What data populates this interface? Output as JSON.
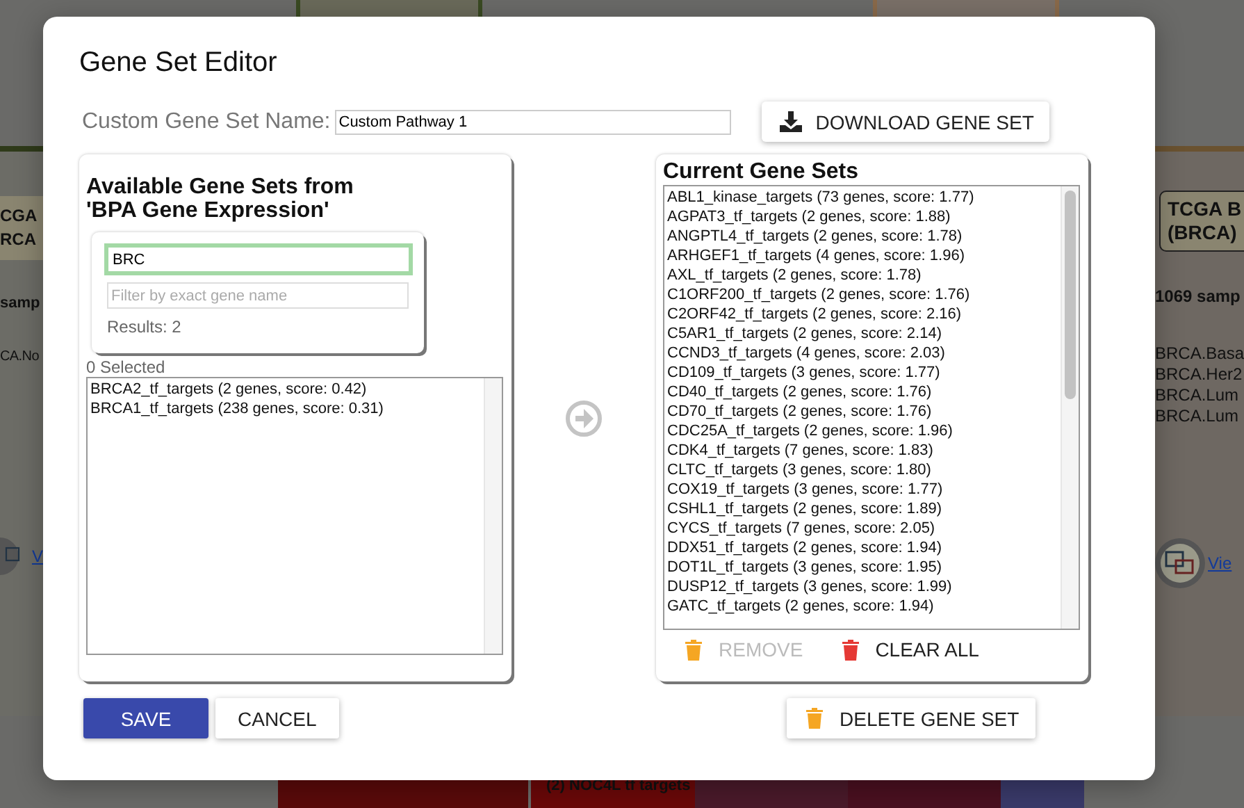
{
  "background": {
    "left_card": {
      "title_lines": [
        "CGA",
        "RCA"
      ],
      "samples": "samp",
      "items": [
        "CA.No"
      ],
      "link": "V"
    },
    "right_card": {
      "title_lines": [
        "TCGA B",
        "(BRCA)"
      ],
      "samples": "1069 samp",
      "items": [
        "BRCA.Basa",
        "BRCA.Her2",
        "BRCA.Lum",
        "BRCA.Lum"
      ],
      "link": "Vie"
    },
    "footer_label": "(2) NOC4L tf targets"
  },
  "dialog": {
    "title": "Gene Set Editor",
    "name_label": "Custom Gene Set Name:",
    "name_value": "Custom Pathway 1",
    "download_button": "DOWNLOAD GENE SET",
    "available": {
      "title": "Available Gene Sets from 'BPA Gene Expression'",
      "search_value": "BRC",
      "filter_placeholder": "Filter by exact gene name",
      "results": "Results: 2",
      "selected_count": "0 Selected",
      "items": [
        {
          "label": "BRCA2_tf_targets (2 genes, score: 0.42)",
          "selected": false
        },
        {
          "label": "BRCA1_tf_targets (238 genes, score: 0.31)",
          "selected": false
        }
      ]
    },
    "current": {
      "title": "Current Gene Sets",
      "items": [
        {
          "label": "ABL1_kinase_targets (73 genes, score: 1.77)",
          "selected": false
        },
        {
          "label": "AGPAT3_tf_targets (2 genes, score: 1.88)",
          "selected": false
        },
        {
          "label": "ANGPTL4_tf_targets (2 genes, score: 1.78)",
          "selected": false
        },
        {
          "label": "ARHGEF1_tf_targets (4 genes, score: 1.96)",
          "selected": false
        },
        {
          "label": "AXL_tf_targets (2 genes, score: 1.78)",
          "selected": false
        },
        {
          "label": "C1ORF200_tf_targets (2 genes, score: 1.76)",
          "selected": false
        },
        {
          "label": "C2ORF42_tf_targets (2 genes, score: 2.16)",
          "selected": false
        },
        {
          "label": "C5AR1_tf_targets (2 genes, score: 2.14)",
          "selected": false
        },
        {
          "label": "CCND3_tf_targets (4 genes, score: 2.03)",
          "selected": false
        },
        {
          "label": "CD109_tf_targets (3 genes, score: 1.77)",
          "selected": false
        },
        {
          "label": "CD40_tf_targets (2 genes, score: 1.76)",
          "selected": false
        },
        {
          "label": "CD70_tf_targets (2 genes, score: 1.76)",
          "selected": false
        },
        {
          "label": "CDC25A_tf_targets (2 genes, score: 1.96)",
          "selected": false
        },
        {
          "label": "CDK4_tf_targets (7 genes, score: 1.83)",
          "selected": false
        },
        {
          "label": "CLTC_tf_targets (3 genes, score: 1.80)",
          "selected": false
        },
        {
          "label": "COX19_tf_targets (3 genes, score: 1.77)",
          "selected": false
        },
        {
          "label": "CSHL1_tf_targets (2 genes, score: 1.89)",
          "selected": false
        },
        {
          "label": "CYCS_tf_targets (7 genes, score: 2.05)",
          "selected": false
        },
        {
          "label": "DDX51_tf_targets (2 genes, score: 1.94)",
          "selected": false
        },
        {
          "label": "DOT1L_tf_targets (3 genes, score: 1.95)",
          "selected": false
        },
        {
          "label": "DUSP12_tf_targets (3 genes, score: 1.99)",
          "selected": false
        },
        {
          "label": "GATC_tf_targets (2 genes, score: 1.94)",
          "selected": false
        }
      ],
      "remove_button": {
        "label": "REMOVE",
        "disabled": true
      },
      "clear_button": "CLEAR ALL"
    },
    "save_button": "SAVE",
    "cancel_button": "CANCEL",
    "delete_button": "DELETE GENE SET"
  }
}
